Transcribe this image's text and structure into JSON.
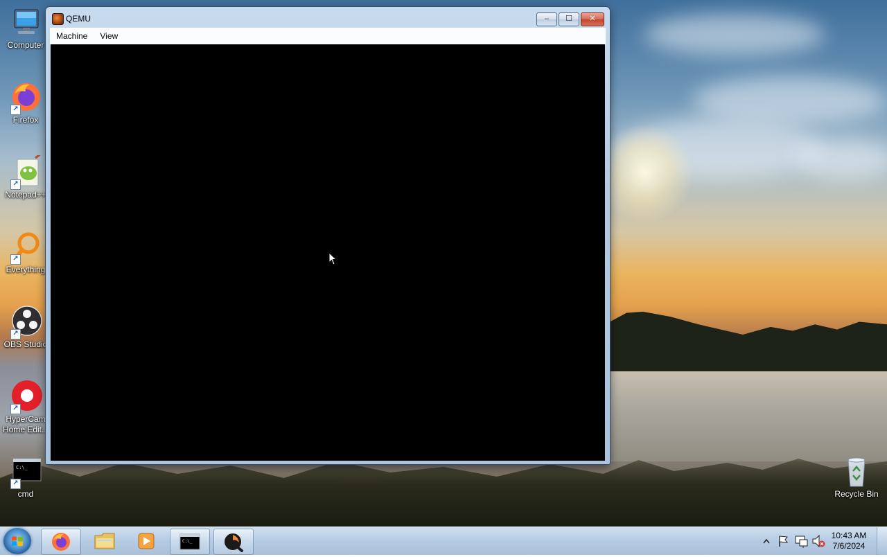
{
  "window": {
    "title": "QEMU",
    "menu": [
      "Machine",
      "View"
    ],
    "controls": {
      "minimize": "–",
      "maximize": "☐",
      "close": "✕"
    }
  },
  "desktop_icons": [
    {
      "label": "Computer",
      "icon": "computer-icon"
    },
    {
      "label": "Firefox",
      "icon": "firefox-icon"
    },
    {
      "label": "Notepad++",
      "icon": "notepad-plus-plus-icon"
    },
    {
      "label": "Everything",
      "icon": "everything-search-icon"
    },
    {
      "label": "OBS Studio",
      "icon": "obs-studio-icon"
    },
    {
      "label": "HyperCam Home Edit...",
      "icon": "hypercam-icon"
    },
    {
      "label": "cmd",
      "icon": "cmd-icon"
    },
    {
      "label": "Recycle Bin",
      "icon": "recycle-bin-icon"
    }
  ],
  "taskbar": {
    "buttons": [
      {
        "name": "firefox",
        "icon": "firefox-icon"
      },
      {
        "name": "file-explorer",
        "icon": "folder-icon"
      },
      {
        "name": "media-player",
        "icon": "media-player-icon"
      },
      {
        "name": "cmd",
        "icon": "cmd-icon"
      },
      {
        "name": "qemu",
        "icon": "qemu-icon"
      }
    ],
    "tray_icons": [
      "show-hidden-icons-icon",
      "action-center-flag-icon",
      "network-icon",
      "volume-muted-icon"
    ],
    "clock": {
      "time": "10:43 AM",
      "date": "7/6/2024"
    }
  },
  "colors": {
    "window_frame": "#b3cbe3",
    "vm_screen": "#000000",
    "close_button": "#c2432b",
    "taskbar": "#b2c9e2"
  }
}
